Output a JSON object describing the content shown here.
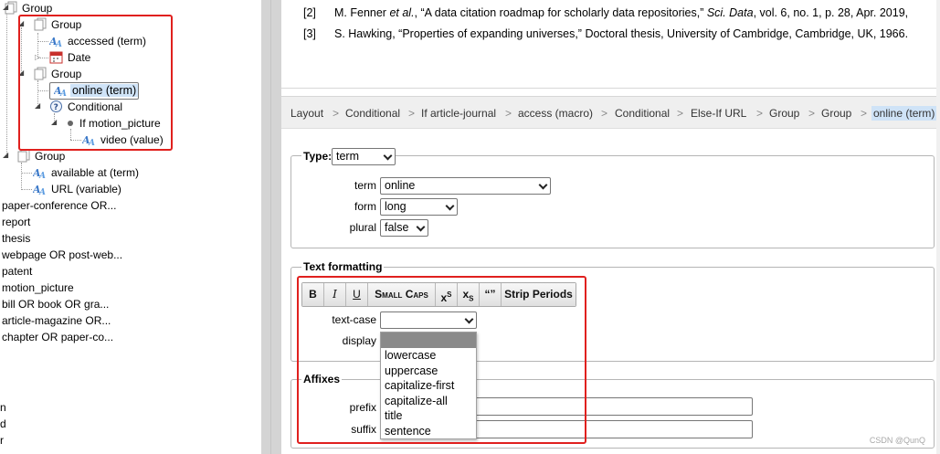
{
  "tree": {
    "group_top": "Group",
    "group_1": "Group",
    "accessed": "accessed (term)",
    "date": "Date",
    "group_2": "Group",
    "online": "online (term)",
    "conditional": "Conditional",
    "if_motion": "If motion_picture",
    "video": "video (value)",
    "group_3": "Group",
    "available": "available at (term)",
    "url": "URL (variable)",
    "items": [
      "paper-conference OR...",
      "report",
      "thesis",
      "webpage OR post-web...",
      "patent",
      "motion_picture",
      "bill OR book OR gra...",
      "article-magazine OR...",
      "chapter OR paper-co..."
    ],
    "edge_chars": [
      "n",
      "d",
      "r"
    ]
  },
  "references": [
    {
      "num": "[2]",
      "pre": "M. Fenner ",
      "em1": "et al.",
      "mid": ", “A data citation roadmap for scholarly data repositories,” ",
      "em2": "Sci. Data",
      "post": ", vol. 6, no. 1, p. 28, Apr. 2019,"
    },
    {
      "num": "[3]",
      "text": "S. Hawking, “Properties of expanding universes,” Doctoral thesis, University of Cambridge, Cambridge, UK, 1966."
    }
  ],
  "breadcrumb": {
    "separator": ">",
    "items": [
      "Layout",
      "Conditional",
      "If article-journal",
      "access (macro)",
      "Conditional",
      "Else-If URL",
      "Group",
      "Group"
    ],
    "current": "online (term)"
  },
  "type_section": {
    "legend": "Type:",
    "type_value": "term",
    "term_label": "term",
    "term_value": "online",
    "form_label": "form",
    "form_value": "long",
    "plural_label": "plural",
    "plural_value": "false"
  },
  "text_formatting": {
    "legend": "Text formatting",
    "buttons": {
      "bold": "B",
      "italic": "I",
      "underline": "U",
      "small_caps": "Small Caps",
      "superscript_base": "x",
      "superscript_sup": "S",
      "subscript_base": "x",
      "subscript_sub": "S",
      "quotes": "“”",
      "strip_periods": "Strip Periods"
    },
    "text_case_label": "text-case",
    "text_case_value": "",
    "display_label": "display",
    "dropdown_options": [
      "",
      "lowercase",
      "uppercase",
      "capitalize-first",
      "capitalize-all",
      "title",
      "sentence"
    ]
  },
  "affixes": {
    "legend": "Affixes",
    "prefix_label": "prefix",
    "suffix_label": "suffix"
  },
  "watermark": "CSDN @QunQ",
  "colors": {
    "highlight_box": "#e0201e",
    "selection": "#cfe3f7",
    "dropdown_highlight": "#8a8a8a"
  }
}
